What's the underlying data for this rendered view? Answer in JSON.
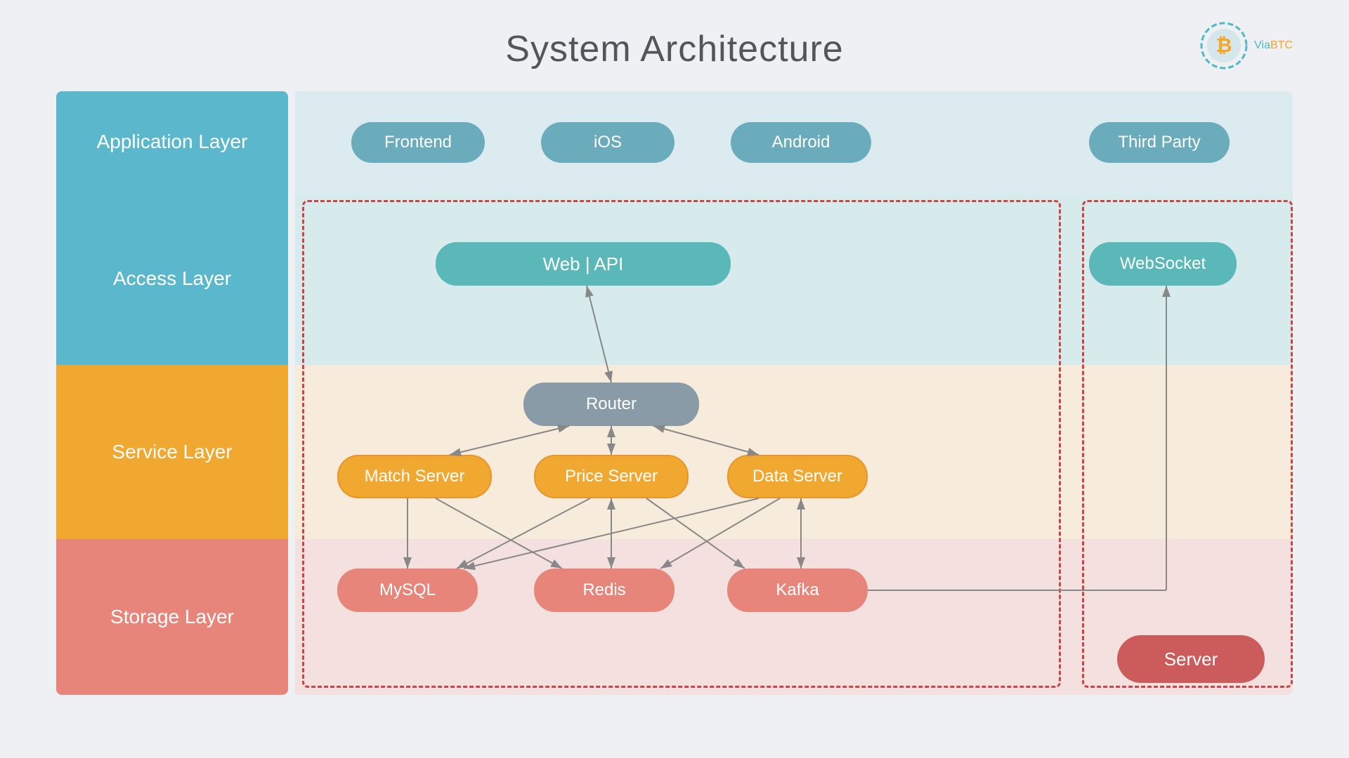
{
  "title": "System Architecture",
  "logo": {
    "via": "Via",
    "btc": "BTC"
  },
  "layers": {
    "application": "Application Layer",
    "access": "Access Layer",
    "service": "Service Layer",
    "storage": "Storage Layer"
  },
  "nodes": {
    "frontend": "Frontend",
    "ios": "iOS",
    "android": "Android",
    "third_party": "Third Party",
    "web_api": "Web  |  API",
    "websocket": "WebSocket",
    "router": "Router",
    "match_server": "Match Server",
    "price_server": "Price Server",
    "data_server": "Data Server",
    "mysql": "MySQL",
    "redis": "Redis",
    "kafka": "Kafka",
    "server": "Server"
  }
}
